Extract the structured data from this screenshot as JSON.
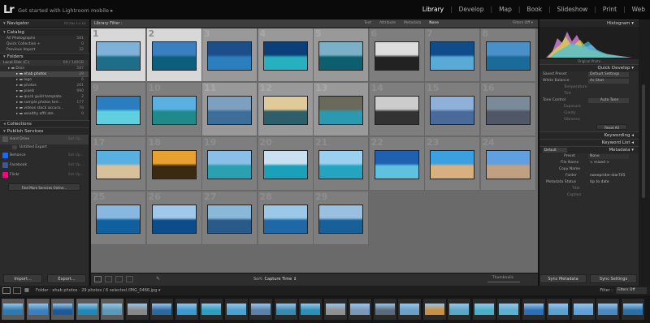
{
  "app": {
    "logo": "Lr",
    "promo": "Get started with Lightroom mobile ▸",
    "modules": [
      "Library",
      "Develop",
      "Map",
      "Book",
      "Slideshow",
      "Print",
      "Web"
    ],
    "active_module": "Library"
  },
  "left_panel": {
    "navigator": "Navigator",
    "navigator_zoom": "FIT  FILL  1:1  3:1",
    "catalog": {
      "title": "Catalog",
      "items": [
        {
          "label": "All Photographs",
          "count": "581"
        },
        {
          "label": "Quick Collection +",
          "count": "0"
        },
        {
          "label": "Previous Import",
          "count": "32"
        }
      ]
    },
    "folders": {
      "title": "Folders",
      "volume": "Local Disk (C:)",
      "volume_size": "69 / 140GB",
      "items": [
        {
          "label": "Dron",
          "count": "587"
        },
        {
          "label": "ehab photos",
          "count": "29"
        },
        {
          "label": "logo",
          "count": "6"
        },
        {
          "label": "photos",
          "count": "261"
        },
        {
          "label": "pixels",
          "count": "990"
        },
        {
          "label": "quick guild template",
          "count": "2"
        },
        {
          "label": "sample photos terr...",
          "count": "177"
        },
        {
          "label": "videos stock accura...",
          "count": "78"
        },
        {
          "label": "wealthy affil ate",
          "count": "9"
        }
      ]
    },
    "collections": "Collections",
    "publish": {
      "title": "Publish Services",
      "services": [
        {
          "label": "Hard Drive",
          "note": "Set Up...",
          "color": "#555555"
        },
        {
          "label": "Untitled Export",
          "note": "",
          "color": "#444444"
        },
        {
          "label": "Behance",
          "note": "Set Up...",
          "color": "#1769ff"
        },
        {
          "label": "Facebook",
          "note": "Set Up...",
          "color": "#3b5998"
        },
        {
          "label": "Flickr",
          "note": "Set Up...",
          "color": "#ff0084"
        }
      ],
      "find_more": "Find More Services Online..."
    },
    "import_label": "Import...",
    "export_label": "Export..."
  },
  "filter_bar": {
    "label": "Library Filter :",
    "options": [
      "Text",
      "Attribute",
      "Metadata",
      "None"
    ],
    "active": "None",
    "filters_off": "Filters Off ▾"
  },
  "grid": {
    "cells": [
      {
        "n": "1",
        "state": "hl",
        "c1": "#7fb2d8",
        "c2": "#1e6e8a"
      },
      {
        "n": "2",
        "state": "hl",
        "c1": "#3a7fc0",
        "c2": "#0c5f7c"
      },
      {
        "n": "3",
        "state": "sel",
        "c1": "#1c4f8a",
        "c2": "#2c7fbf"
      },
      {
        "n": "4",
        "state": "sel",
        "c1": "#0b3f7a",
        "c2": "#27b0c0"
      },
      {
        "n": "5",
        "state": "sel",
        "c1": "#7ab0c8",
        "c2": "#0d5e6e"
      },
      {
        "n": "6",
        "state": "",
        "c1": "#dddddd",
        "c2": "#222222"
      },
      {
        "n": "7",
        "state": "",
        "c1": "#0f4c8a",
        "c2": "#5aaad8"
      },
      {
        "n": "8",
        "state": "",
        "c1": "#4a90c8",
        "c2": "#1a6a9a"
      },
      {
        "n": "9",
        "state": "",
        "c1": "#2a7ec0",
        "c2": "#5ed0e0"
      },
      {
        "n": "10",
        "state": "",
        "c1": "#5ab0e0",
        "c2": "#1f8a8a"
      },
      {
        "n": "11",
        "state": "sel",
        "c1": "#7ea0c0",
        "c2": "#3d6e9a"
      },
      {
        "n": "12",
        "state": "sel",
        "c1": "#e0ca9a",
        "c2": "#2d5e6a"
      },
      {
        "n": "13",
        "state": "sel",
        "c1": "#6a6a5a",
        "c2": "#2b9ab0"
      },
      {
        "n": "14",
        "state": "",
        "c1": "#cccccc",
        "c2": "#333333"
      },
      {
        "n": "15",
        "state": "",
        "c1": "#8fb0d8",
        "c2": "#4a6a9a"
      },
      {
        "n": "16",
        "state": "",
        "c1": "#7a8a98",
        "c2": "#505868"
      },
      {
        "n": "17",
        "state": "",
        "c1": "#58b0e0",
        "c2": "#d8c09a"
      },
      {
        "n": "18",
        "state": "",
        "c1": "#e8a030",
        "c2": "#3a2a10"
      },
      {
        "n": "19",
        "state": "",
        "c1": "#8ac0e8",
        "c2": "#2aa0b0"
      },
      {
        "n": "20",
        "state": "",
        "c1": "#c8e0f0",
        "c2": "#1aa0b8"
      },
      {
        "n": "21",
        "state": "",
        "c1": "#9ad0f0",
        "c2": "#23a5c0"
      },
      {
        "n": "22",
        "state": "",
        "c1": "#2060b0",
        "c2": "#60c0e0"
      },
      {
        "n": "23",
        "state": "",
        "c1": "#3aa0e0",
        "c2": "#d8b080"
      },
      {
        "n": "24",
        "state": "",
        "c1": "#60a0e0",
        "c2": "#c0a080"
      },
      {
        "n": "25",
        "state": "",
        "c1": "#88b8e0",
        "c2": "#1060a0"
      },
      {
        "n": "26",
        "state": "",
        "c1": "#a0c8e8",
        "c2": "#0c4c8a"
      },
      {
        "n": "27",
        "state": "",
        "c1": "#8ab8d8",
        "c2": "#2a5a8a"
      },
      {
        "n": "28",
        "state": "",
        "c1": "#9ac8e8",
        "c2": "#1e68a8"
      },
      {
        "n": "29",
        "state": "",
        "c1": "#9ac0e0",
        "c2": "#18609a"
      }
    ]
  },
  "toolbar": {
    "sort_label": "Sort:",
    "sort_value": "Capture Time ↕",
    "thumbnails": "Thumbnails"
  },
  "right_panel": {
    "histogram": "Histogram",
    "original_photo": "Original Photo",
    "quick_develop": "Quick Develop",
    "saved_preset": {
      "label": "Saved Preset",
      "value": "Default Settings"
    },
    "white_balance": {
      "label": "White Balance",
      "value": "As Shot"
    },
    "temperature": "Temperature",
    "tint": "Tint",
    "tone_control": {
      "label": "Tone Control",
      "value": "Auto Tone"
    },
    "exposure": "Exposure",
    "clarity": "Clarity",
    "vibrance": "Vibrance",
    "reset_all": "Reset All",
    "keywording": "Keywording",
    "keyword_list": "Keyword List",
    "metadata": "Metadata",
    "metadata_preset": "Default",
    "preset": {
      "label": "Preset",
      "value": "None"
    },
    "file_name": {
      "label": "File Name",
      "value": "< mixed >"
    },
    "copy_name": {
      "label": "Copy Name",
      "value": ""
    },
    "folder": {
      "label": "Folder",
      "value": "sweeprider-star745"
    },
    "metadata_status": {
      "label": "Metadata Status",
      "value": "Up to date"
    },
    "title": "Title",
    "caption": "Caption",
    "sync_metadata": "Sync Metadata",
    "sync_settings": "Sync Settings"
  },
  "filmstrip_bar": {
    "source": "Folder : ehab photos",
    "count": "29 photos / 6 selected /IMG_0466.jpg ▾",
    "filter": "Filter :",
    "filters_off": "Filters Off"
  },
  "filmstrip": {
    "thumbs": [
      {
        "sel": true,
        "c": "#2d7ab0"
      },
      {
        "sel": true,
        "c": "#3a80c0"
      },
      {
        "sel": true,
        "c": "#1a5a9a"
      },
      {
        "sel": true,
        "c": "#1e88b8"
      },
      {
        "sel": true,
        "c": "#5a9ab8"
      },
      {
        "sel": false,
        "c": "#888888"
      },
      {
        "sel": false,
        "c": "#2a6aa0"
      },
      {
        "sel": false,
        "c": "#3a9ad0"
      },
      {
        "sel": false,
        "c": "#2aa0c0"
      },
      {
        "sel": false,
        "c": "#4aa0d0"
      },
      {
        "sel": false,
        "c": "#5a80a8"
      },
      {
        "sel": false,
        "c": "#3a8ab0"
      },
      {
        "sel": false,
        "c": "#2a90b8"
      },
      {
        "sel": false,
        "c": "#909090"
      },
      {
        "sel": false,
        "c": "#7a98b8"
      },
      {
        "sel": false,
        "c": "#5a6a7a"
      },
      {
        "sel": false,
        "c": "#6aa0c8"
      },
      {
        "sel": false,
        "c": "#c89040"
      },
      {
        "sel": false,
        "c": "#5aa8c8"
      },
      {
        "sel": false,
        "c": "#48b0c8"
      },
      {
        "sel": false,
        "c": "#5ab0d0"
      },
      {
        "sel": false,
        "c": "#2a70b8"
      },
      {
        "sel": false,
        "c": "#5aa0d0"
      },
      {
        "sel": false,
        "c": "#60a0d8"
      },
      {
        "sel": false,
        "c": "#4a88c0"
      },
      {
        "sel": false,
        "c": "#2a70a8"
      }
    ]
  }
}
